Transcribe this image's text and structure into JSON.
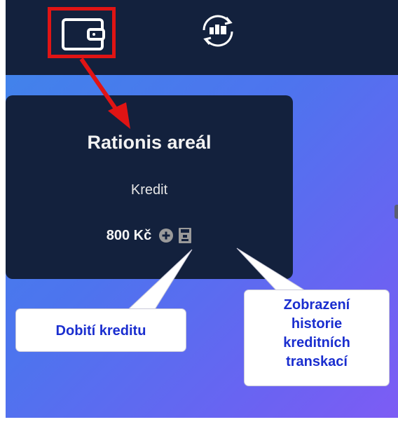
{
  "header": {
    "tabs": [
      {
        "icon": "wallet-icon",
        "active": true
      },
      {
        "icon": "exchange-icon",
        "active": false
      }
    ]
  },
  "card": {
    "title": "Rationis areál",
    "subtitle": "Kredit",
    "amount": "800 Kč",
    "actions": [
      {
        "icon": "plus-circle-icon"
      },
      {
        "icon": "history-icon"
      }
    ]
  },
  "callouts": {
    "topup": "Dobití kreditu",
    "history_lines": [
      "Zobrazení",
      "historie",
      "kreditních",
      "transkací"
    ]
  },
  "colors": {
    "header_bg": "#13213d",
    "card_bg": "#13213d",
    "highlight": "#e01414",
    "callout_text": "#1a2ecf",
    "gradient_start": "#3f86ea",
    "gradient_end": "#7d5cf4"
  }
}
